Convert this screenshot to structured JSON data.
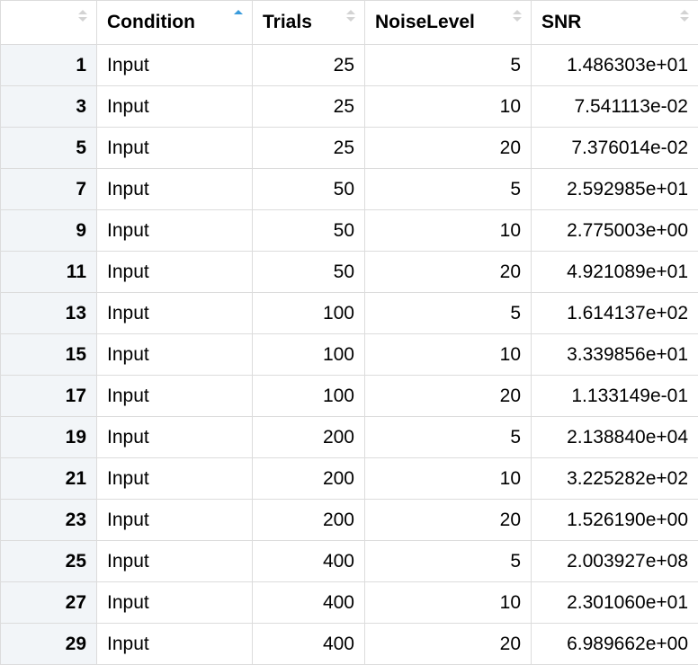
{
  "table": {
    "columns": [
      {
        "label": "",
        "key": "row",
        "sort": "none"
      },
      {
        "label": "Condition",
        "key": "condition",
        "sort": "asc"
      },
      {
        "label": "Trials",
        "key": "trials",
        "sort": "none"
      },
      {
        "label": "NoiseLevel",
        "key": "noise",
        "sort": "none"
      },
      {
        "label": "SNR",
        "key": "snr",
        "sort": "none"
      }
    ],
    "rows": [
      {
        "row": "1",
        "condition": "Input",
        "trials": "25",
        "noise": "5",
        "snr": "1.486303e+01"
      },
      {
        "row": "3",
        "condition": "Input",
        "trials": "25",
        "noise": "10",
        "snr": "7.541113e-02"
      },
      {
        "row": "5",
        "condition": "Input",
        "trials": "25",
        "noise": "20",
        "snr": "7.376014e-02"
      },
      {
        "row": "7",
        "condition": "Input",
        "trials": "50",
        "noise": "5",
        "snr": "2.592985e+01"
      },
      {
        "row": "9",
        "condition": "Input",
        "trials": "50",
        "noise": "10",
        "snr": "2.775003e+00"
      },
      {
        "row": "11",
        "condition": "Input",
        "trials": "50",
        "noise": "20",
        "snr": "4.921089e+01"
      },
      {
        "row": "13",
        "condition": "Input",
        "trials": "100",
        "noise": "5",
        "snr": "1.614137e+02"
      },
      {
        "row": "15",
        "condition": "Input",
        "trials": "100",
        "noise": "10",
        "snr": "3.339856e+01"
      },
      {
        "row": "17",
        "condition": "Input",
        "trials": "100",
        "noise": "20",
        "snr": "1.133149e-01"
      },
      {
        "row": "19",
        "condition": "Input",
        "trials": "200",
        "noise": "5",
        "snr": "2.138840e+04"
      },
      {
        "row": "21",
        "condition": "Input",
        "trials": "200",
        "noise": "10",
        "snr": "3.225282e+02"
      },
      {
        "row": "23",
        "condition": "Input",
        "trials": "200",
        "noise": "20",
        "snr": "1.526190e+00"
      },
      {
        "row": "25",
        "condition": "Input",
        "trials": "400",
        "noise": "5",
        "snr": "2.003927e+08"
      },
      {
        "row": "27",
        "condition": "Input",
        "trials": "400",
        "noise": "10",
        "snr": "2.301060e+01"
      },
      {
        "row": "29",
        "condition": "Input",
        "trials": "400",
        "noise": "20",
        "snr": "6.989662e+00"
      }
    ]
  },
  "colors": {
    "sort_active": "#3a9bdc",
    "sort_inactive": "#d3d3d3",
    "row_name_bg": "#f2f5f8",
    "grid": "#dcdcdc"
  }
}
